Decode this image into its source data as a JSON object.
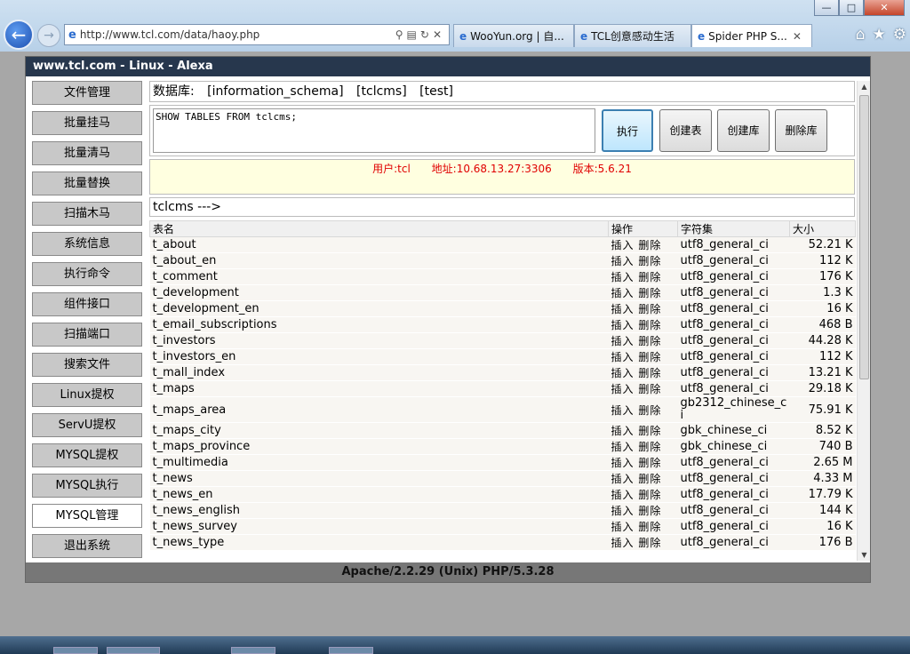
{
  "browser": {
    "url": "http://www.tcl.com/data/haoy.php",
    "tabs": [
      {
        "label": "WooYun.org | 自..."
      },
      {
        "label": "TCL创意感动生活"
      },
      {
        "label": "Spider PHP S..."
      }
    ],
    "window_controls": {
      "minimize": "—",
      "maximize": "□",
      "close": "✕"
    }
  },
  "app": {
    "title": "www.tcl.com - Linux - Alexa",
    "sidebar": [
      "文件管理",
      "批量挂马",
      "批量清马",
      "批量替换",
      "扫描木马",
      "系统信息",
      "执行命令",
      "组件接口",
      "扫描端口",
      "搜索文件",
      "Linux提权",
      "ServU提权",
      "MYSQL提权",
      "MYSQL执行",
      "MYSQL管理",
      "退出系统"
    ],
    "active_sidebar": "MYSQL管理",
    "db_label": "数据库:",
    "databases": [
      "[information_schema]",
      "[tclcms]",
      "[test]"
    ],
    "sql_query": "SHOW TABLES FROM tclcms;",
    "buttons": {
      "execute": "执行",
      "create_table": "创建表",
      "create_db": "创建库",
      "drop_db": "删除库"
    },
    "info": {
      "user": "用户:tcl",
      "address": "地址:10.68.13.27:3306",
      "version": "版本:5.6.21"
    },
    "table_header": "tclcms --->",
    "columns": {
      "name": "表名",
      "ops": "操作",
      "charset": "字符集",
      "size": "大小"
    },
    "op_insert": "插入",
    "op_delete": "删除",
    "rows": [
      {
        "name": "t_about",
        "charset": "utf8_general_ci",
        "size": "52.21 K"
      },
      {
        "name": "t_about_en",
        "charset": "utf8_general_ci",
        "size": "112 K"
      },
      {
        "name": "t_comment",
        "charset": "utf8_general_ci",
        "size": "176 K"
      },
      {
        "name": "t_development",
        "charset": "utf8_general_ci",
        "size": "1.3 K"
      },
      {
        "name": "t_development_en",
        "charset": "utf8_general_ci",
        "size": "16 K"
      },
      {
        "name": "t_email_subscriptions",
        "charset": "utf8_general_ci",
        "size": "468 B"
      },
      {
        "name": "t_investors",
        "charset": "utf8_general_ci",
        "size": "44.28 K"
      },
      {
        "name": "t_investors_en",
        "charset": "utf8_general_ci",
        "size": "112 K"
      },
      {
        "name": "t_mall_index",
        "charset": "utf8_general_ci",
        "size": "13.21 K"
      },
      {
        "name": "t_maps",
        "charset": "utf8_general_ci",
        "size": "29.18 K"
      },
      {
        "name": "t_maps_area",
        "charset": "gb2312_chinese_ci",
        "size": "75.91 K"
      },
      {
        "name": "t_maps_city",
        "charset": "gbk_chinese_ci",
        "size": "8.52 K"
      },
      {
        "name": "t_maps_province",
        "charset": "gbk_chinese_ci",
        "size": "740 B"
      },
      {
        "name": "t_multimedia",
        "charset": "utf8_general_ci",
        "size": "2.65 M"
      },
      {
        "name": "t_news",
        "charset": "utf8_general_ci",
        "size": "4.33 M"
      },
      {
        "name": "t_news_en",
        "charset": "utf8_general_ci",
        "size": "17.79 K"
      },
      {
        "name": "t_news_english",
        "charset": "utf8_general_ci",
        "size": "144 K"
      },
      {
        "name": "t_news_survey",
        "charset": "utf8_general_ci",
        "size": "16 K"
      },
      {
        "name": "t_news_type",
        "charset": "utf8_general_ci",
        "size": "176 B"
      }
    ],
    "footer": "Apache/2.2.29 (Unix) PHP/5.3.28"
  }
}
